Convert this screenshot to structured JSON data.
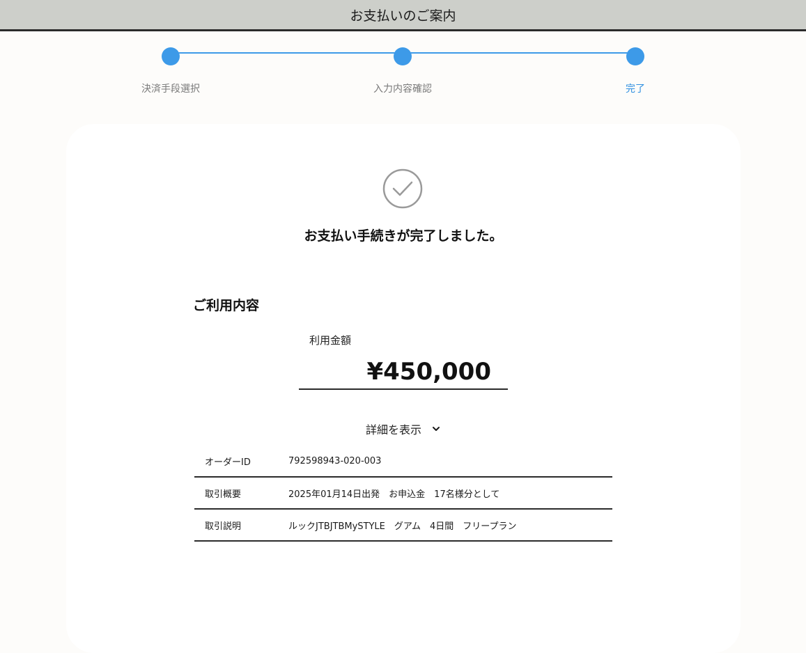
{
  "header": {
    "title": "お支払いのご案内"
  },
  "stepper": {
    "steps": [
      {
        "label": "決済手段選択",
        "state": "completed"
      },
      {
        "label": "入力内容確認",
        "state": "completed"
      },
      {
        "label": "完了",
        "state": "current"
      }
    ]
  },
  "main": {
    "icon": "check-circle-icon",
    "done_message": "お支払い手続きが完了しました。",
    "section_title": "ご利用内容",
    "amount_label": "利用金額",
    "amount_value": "¥450,000",
    "details_toggle_label": "詳細を表示",
    "details": [
      {
        "key": "オーダーID",
        "value": "792598943-020-003"
      },
      {
        "key": "取引概要",
        "value": "2025年01月14日出発　お申込金　17名様分として"
      },
      {
        "key": "取引説明",
        "value": "ルックJTBJTBMySTYLE　グアム　4日間　フリープラン"
      }
    ]
  },
  "colors": {
    "accent": "#3d9ae8",
    "header_bg": "#cdcfca",
    "page_bg": "#fdfcfa"
  }
}
